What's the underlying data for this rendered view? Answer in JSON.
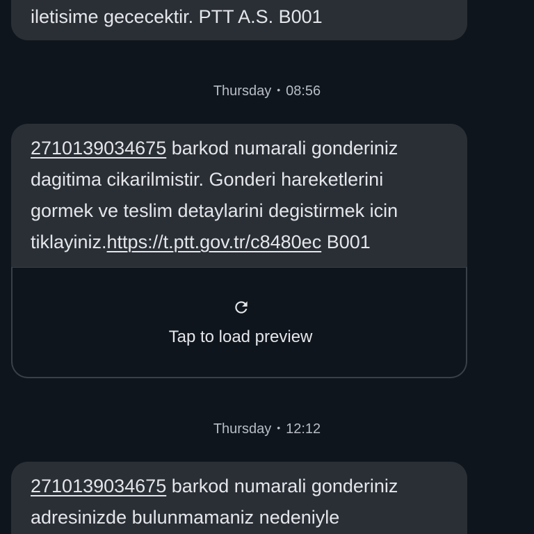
{
  "messages": [
    {
      "text_tail": "iletisime gececektir. PTT A.S. B001"
    },
    {
      "timestamp_day": "Thursday",
      "timestamp_sep": "•",
      "timestamp_time": "08:56",
      "barcode_link": "2710139034675",
      "line1_rest": " barkod numarali gonderiniz",
      "line2": "dagitima cikarilmistir. Gonderi hareketlerini",
      "line3": "gormek ve teslim detaylarini degistirmek icin",
      "line4_prefix": "tiklayiniz.",
      "url_link": "https://t.ptt.gov.tr/c8480ec",
      "line4_suffix": " B001",
      "preview_label": "Tap to load preview",
      "preview_icon": "refresh-icon"
    },
    {
      "timestamp_day": "Thursday",
      "timestamp_sep": "•",
      "timestamp_time": "12:12",
      "barcode_link": "2710139034675",
      "line1_rest": " barkod numarali gonderiniz",
      "line2": "adresinizde bulunmamaniz nedeniyle"
    }
  ]
}
